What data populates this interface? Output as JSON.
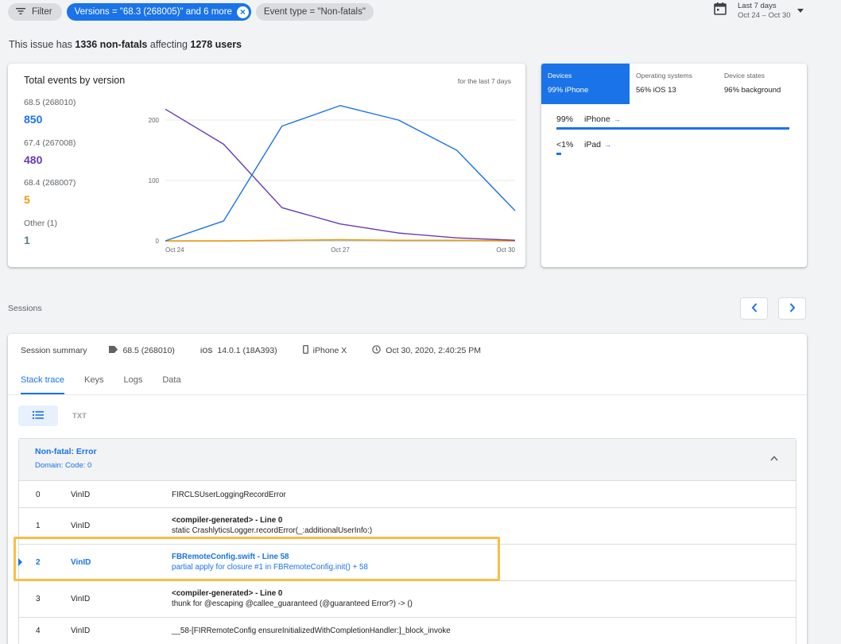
{
  "filters": {
    "filter_label": "Filter",
    "versions_chip": "Versions = \"68.3 (268005)\" and 6 more",
    "event_type_chip": "Event type = \"Non-fatals\""
  },
  "date_range": {
    "label": "Last 7 days",
    "range": "Oct 24 – Oct 30"
  },
  "summary": {
    "prefix": "This issue has ",
    "count": "1336 non-fatals",
    "middle": " affecting ",
    "users": "1278 users"
  },
  "versions_card": {
    "title": "Total events by version",
    "period": "for the last 7 days",
    "legend": [
      {
        "name": "68.5 (268010)",
        "value": "850",
        "color": "#1a73e8"
      },
      {
        "name": "67.4 (267008)",
        "value": "480",
        "color": "#673ab7"
      },
      {
        "name": "68.4 (268007)",
        "value": "5",
        "color": "#f29900"
      },
      {
        "name": "Other (1)",
        "value": "1",
        "color": "#5f7f8c"
      }
    ]
  },
  "chart_data": {
    "type": "line",
    "x": [
      "Oct 24",
      "Oct 25",
      "Oct 26",
      "Oct 27",
      "Oct 28",
      "Oct 29",
      "Oct 30"
    ],
    "x_tick_labels": [
      "Oct 24",
      "Oct 27",
      "Oct 30"
    ],
    "y_ticks": [
      0,
      100,
      200
    ],
    "ylim": [
      0,
      225
    ],
    "grid": true,
    "series": [
      {
        "name": "68.5 (268010)",
        "color": "#1a73e8",
        "values": [
          0,
          33,
          190,
          224,
          200,
          150,
          50
        ]
      },
      {
        "name": "67.4 (267008)",
        "color": "#673ab7",
        "values": [
          218,
          160,
          55,
          28,
          13,
          5,
          1
        ]
      },
      {
        "name": "68.4 (268007)",
        "color": "#f29900",
        "values": [
          0,
          0,
          1,
          2,
          1,
          1,
          0
        ]
      },
      {
        "name": "Other (1)",
        "color": "#b0bec5",
        "values": [
          0,
          0,
          0,
          1,
          0,
          0,
          0
        ]
      }
    ]
  },
  "devices_card": {
    "tabs": [
      {
        "title": "Devices",
        "value": "99% iPhone"
      },
      {
        "title": "Operating systems",
        "value": "56% iOS 13"
      },
      {
        "title": "Device states",
        "value": "96% background"
      }
    ],
    "rows": [
      {
        "pct": "99%",
        "name": "iPhone",
        "share": 0.99
      },
      {
        "pct": "<1%",
        "name": "iPad",
        "share": 0.02
      }
    ],
    "arrow": "→"
  },
  "sessions": {
    "label": "Sessions",
    "summary_title": "Session summary",
    "version": "68.5 (268010)",
    "os_icon": "iOS",
    "os": "14.0.1 (18A393)",
    "device": "iPhone X",
    "time": "Oct 30, 2020, 2:40:25 PM",
    "tabs": [
      "Stack trace",
      "Keys",
      "Logs",
      "Data"
    ],
    "txt_toggle": "TXT"
  },
  "trace": {
    "title": "Non-fatal: Error",
    "subtitle": "Domain: Code: 0",
    "frames": [
      {
        "idx": "0",
        "lib": "VinID",
        "line1": "FIRCLSUserLoggingRecordError",
        "line2": ""
      },
      {
        "idx": "1",
        "lib": "VinID",
        "line1": "<compiler-generated> - Line 0",
        "line2": "static CrashlyticsLogger.recordError(_:additionalUserInfo:)"
      },
      {
        "idx": "2",
        "lib": "VinID",
        "line1": "FBRemoteConfig.swift - Line 58",
        "line2": "partial apply for closure #1 in FBRemoteConfig.init() + 58"
      },
      {
        "idx": "3",
        "lib": "VinID",
        "line1": "<compiler-generated> - Line 0",
        "line2": "thunk for @escaping @callee_guaranteed (@guaranteed Error?) -> ()"
      },
      {
        "idx": "4",
        "lib": "VinID",
        "line1": "__58-[FIRRemoteConfig ensureInitializedWithCompletionHandler:]_block_invoke",
        "line2": ""
      }
    ]
  },
  "icons": {
    "filter": "filter-icon",
    "calendar": "calendar-icon",
    "tag": "tag-icon",
    "phone": "phone-icon",
    "clock": "clock-icon"
  }
}
